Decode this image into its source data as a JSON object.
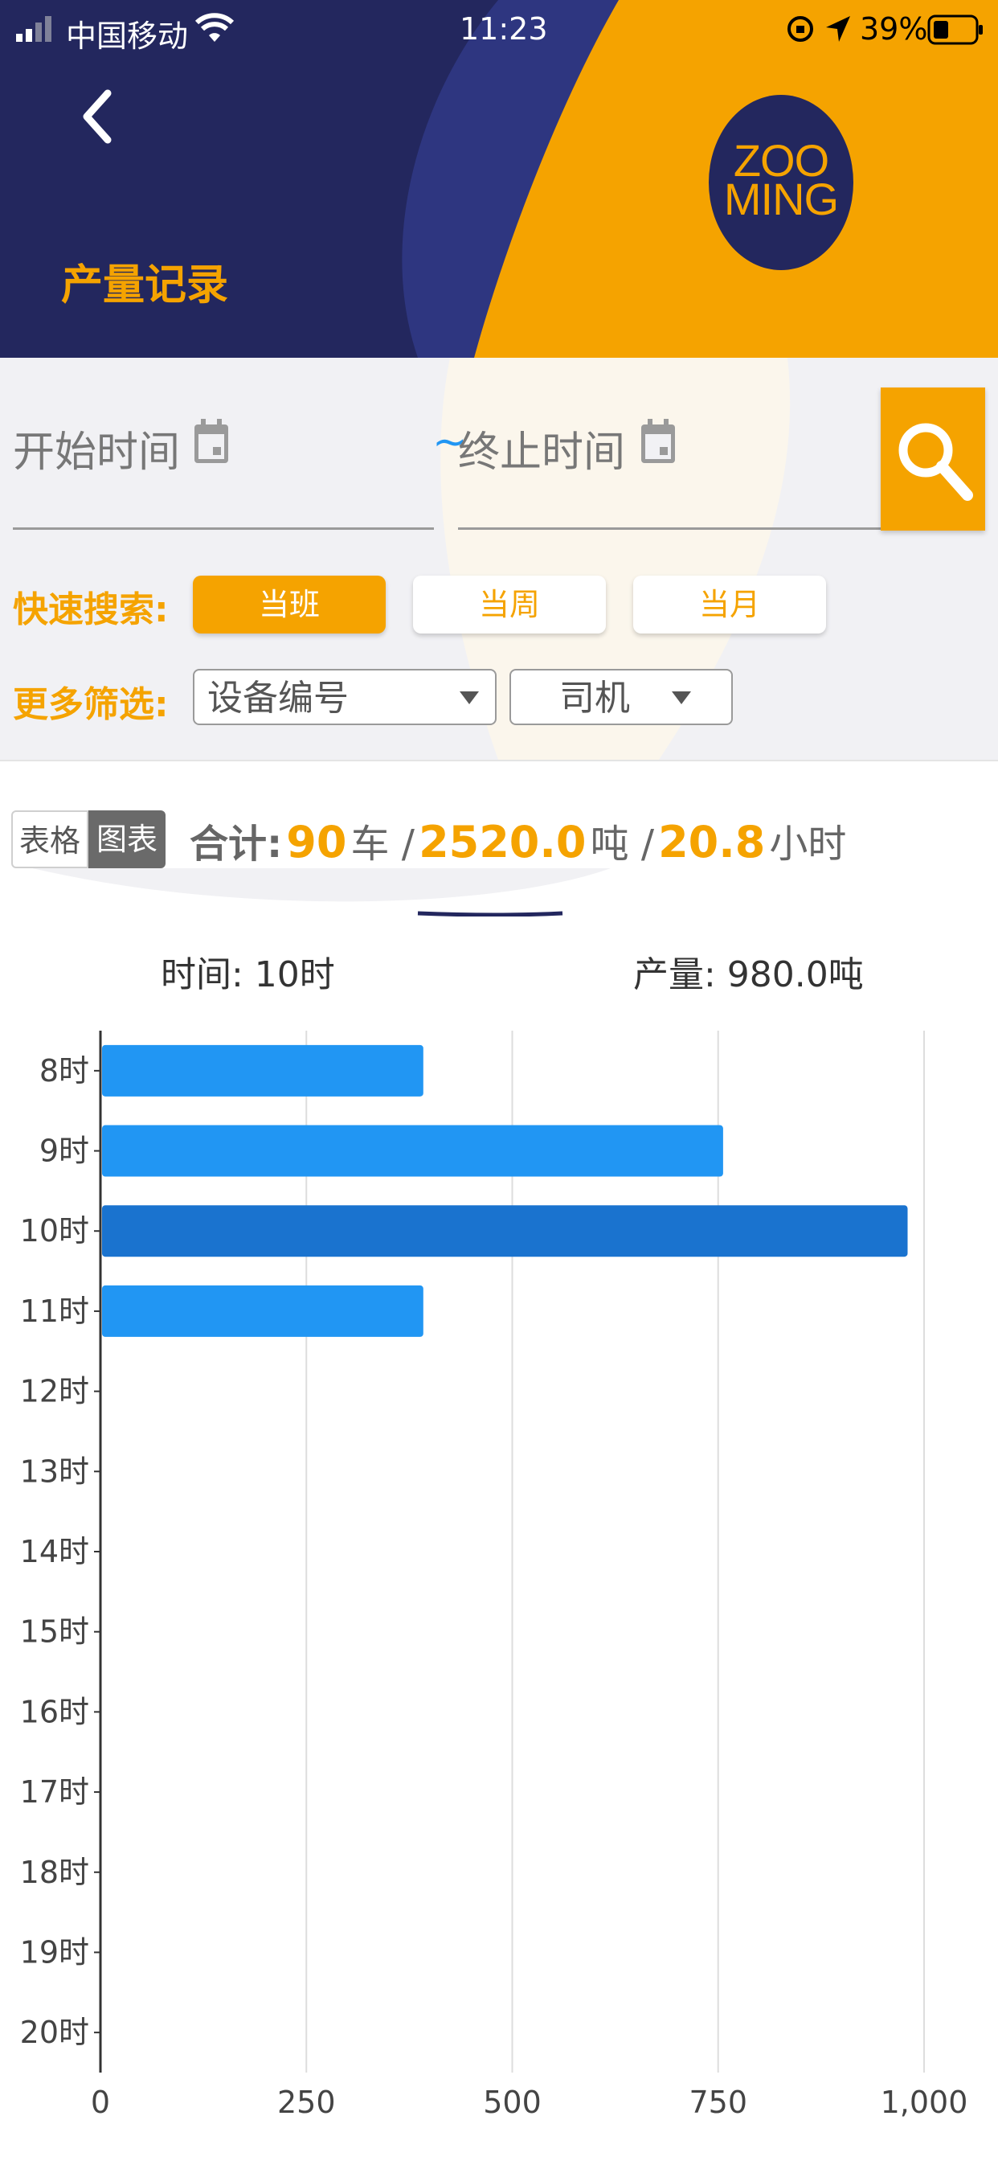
{
  "status_bar": {
    "carrier": "中国移动",
    "time": "11:23",
    "battery": "39%"
  },
  "header": {
    "title": "产量记录",
    "logo_line1": "ZOO",
    "logo_line2": "MING"
  },
  "filters": {
    "start_placeholder": "开始时间",
    "range_sep": "~",
    "end_placeholder": "终止时间",
    "quick_label": "快速搜索:",
    "quick_options": [
      "当班",
      "当周",
      "当月"
    ],
    "quick_selected": "当班",
    "more_label": "更多筛选:",
    "device_select": "设备编号",
    "driver_select": "司机"
  },
  "summary": {
    "toggle_table": "表格",
    "toggle_chart": "图表",
    "total_label": "合计:",
    "trucks": "90",
    "trucks_unit": "车 /",
    "tons": "2520.0",
    "tons_unit": "吨 /",
    "hours": "20.8",
    "hours_unit": "小时"
  },
  "tooltip": {
    "time_text": "时间: 10时",
    "output_text": "产量: 980.0吨"
  },
  "colors": {
    "accent": "#f5a300",
    "navy": "#23275e",
    "bar": "#2196f3",
    "bar_highlight": "#1a73cf"
  },
  "chart_data": {
    "type": "bar",
    "orientation": "horizontal",
    "categories": [
      "8时",
      "9时",
      "10时",
      "11时",
      "12时",
      "13时",
      "14时",
      "15时",
      "16时",
      "17时",
      "18时",
      "19时",
      "20时"
    ],
    "values": [
      392,
      756,
      980,
      392,
      0,
      0,
      0,
      0,
      0,
      0,
      0,
      0,
      0
    ],
    "highlighted_category": "10时",
    "xlim": [
      0,
      1000
    ],
    "xticks": [
      "0",
      "250",
      "500",
      "750",
      "1,000"
    ],
    "grid": true
  }
}
